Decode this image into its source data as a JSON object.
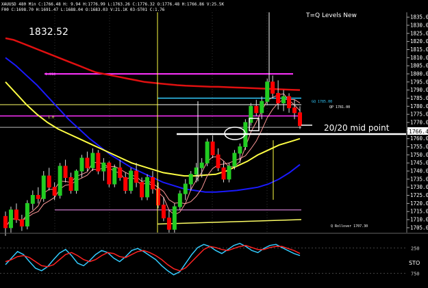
{
  "header": {
    "line1": "XAUUSD 480 Min  C:1766.48  H: 9.94  H:1776.99  L:1763.26  C:1776.32  O:1776.48  H:1766.86  V:25.5K",
    "line2": "F00  C:1698.70  H:1691.47  L:1688.04  O:1683.03  V:21.1K  03-ST01  C:1.76"
  },
  "annotations": {
    "big_price": "1832.52",
    "title": "T=Q Levels New",
    "mid_point": "20/20 mid point",
    "level_1818": "1.818",
    "level_gq": "GQ 1785.00",
    "level_qp": "QP 1781.00",
    "level_small_left": "1.0",
    "level_rollover": "Q Rollover 1707.30",
    "sto_label": "STO"
  },
  "colors": {
    "background": "#000000",
    "up_candle": "#22cc22",
    "down_candle": "#ff0000",
    "ma_red": "#e01010",
    "ma_blue": "#1a1aff",
    "ma_yellow": "#ffff44",
    "ma_pink": "#ff9999",
    "level_magenta": "#ff33ff",
    "level_cyan": "#33ccff",
    "level_white": "#ffffff",
    "sto_red": "#ff2222",
    "sto_cyan": "#33ccff"
  },
  "chart_data": {
    "type": "candlestick",
    "y_ticks": [
      1835,
      1830,
      1825,
      1820,
      1815,
      1810,
      1805,
      1800,
      1795,
      1790,
      1785,
      1780,
      1775,
      1770,
      1765,
      1760,
      1755,
      1750,
      1745,
      1740,
      1735,
      1730,
      1725,
      1720,
      1715,
      1710,
      1705
    ],
    "ylim": [
      1702,
      1838
    ],
    "current_price": "1766.4",
    "ohlc": [
      [
        1712,
        1715,
        1700,
        1705
      ],
      [
        1705,
        1718,
        1702,
        1716
      ],
      [
        1716,
        1720,
        1708,
        1710
      ],
      [
        1710,
        1713,
        1703,
        1706
      ],
      [
        1706,
        1722,
        1704,
        1720
      ],
      [
        1720,
        1728,
        1716,
        1725
      ],
      [
        1725,
        1730,
        1720,
        1723
      ],
      [
        1723,
        1740,
        1721,
        1737
      ],
      [
        1737,
        1742,
        1728,
        1730
      ],
      [
        1730,
        1733,
        1722,
        1725
      ],
      [
        1725,
        1745,
        1723,
        1743
      ],
      [
        1743,
        1747,
        1733,
        1736
      ],
      [
        1736,
        1739,
        1726,
        1728
      ],
      [
        1728,
        1741,
        1726,
        1740
      ],
      [
        1740,
        1750,
        1736,
        1748
      ],
      [
        1748,
        1752,
        1740,
        1742
      ],
      [
        1742,
        1754,
        1740,
        1751
      ],
      [
        1751,
        1753,
        1738,
        1740
      ],
      [
        1740,
        1748,
        1734,
        1745
      ],
      [
        1745,
        1746,
        1730,
        1732
      ],
      [
        1732,
        1744,
        1730,
        1742
      ],
      [
        1742,
        1747,
        1734,
        1736
      ],
      [
        1736,
        1739,
        1726,
        1728
      ],
      [
        1728,
        1742,
        1726,
        1740
      ],
      [
        1740,
        1745,
        1730,
        1733
      ],
      [
        1733,
        1736,
        1722,
        1724
      ],
      [
        1724,
        1738,
        1722,
        1736
      ],
      [
        1736,
        1740,
        1726,
        1729
      ],
      [
        1729,
        1733,
        1717,
        1719
      ],
      [
        1719,
        1724,
        1709,
        1711
      ],
      [
        1711,
        1716,
        1702,
        1704
      ],
      [
        1704,
        1720,
        1702,
        1718
      ],
      [
        1718,
        1728,
        1716,
        1726
      ],
      [
        1726,
        1735,
        1722,
        1732
      ],
      [
        1732,
        1740,
        1728,
        1738
      ],
      [
        1738,
        1745,
        1733,
        1742
      ],
      [
        1742,
        1748,
        1736,
        1745
      ],
      [
        1745,
        1760,
        1743,
        1758
      ],
      [
        1758,
        1762,
        1748,
        1750
      ],
      [
        1750,
        1754,
        1740,
        1742
      ],
      [
        1742,
        1746,
        1733,
        1735
      ],
      [
        1735,
        1745,
        1733,
        1743
      ],
      [
        1743,
        1753,
        1741,
        1751
      ],
      [
        1751,
        1757,
        1745,
        1755
      ],
      [
        1755,
        1772,
        1753,
        1770
      ],
      [
        1770,
        1782,
        1768,
        1780
      ],
      [
        1780,
        1784,
        1774,
        1776
      ],
      [
        1776,
        1786,
        1772,
        1783
      ],
      [
        1783,
        1797,
        1781,
        1795
      ],
      [
        1795,
        1799,
        1785,
        1788
      ],
      [
        1788,
        1796,
        1778,
        1782
      ],
      [
        1782,
        1790,
        1777,
        1786
      ],
      [
        1786,
        1788,
        1776,
        1779
      ],
      [
        1779,
        1784,
        1772,
        1776
      ],
      [
        1776,
        1780,
        1766,
        1768
      ]
    ],
    "moving_averages": [
      {
        "color": "ma_red",
        "values": [
          1822,
          1821,
          1819,
          1817,
          1815,
          1813,
          1811,
          1809,
          1807,
          1805,
          1803,
          1801,
          1800,
          1799,
          1798,
          1797,
          1796,
          1795,
          1794.5,
          1794,
          1793.5,
          1793,
          1792.7,
          1792.5,
          1792.3,
          1792.1,
          1792,
          1791.8,
          1791.6,
          1791.4,
          1791.2,
          1791,
          1790.8,
          1790.6,
          1790.4,
          1790.2,
          1790
        ]
      },
      {
        "color": "ma_blue",
        "values": [
          1810,
          1805,
          1799,
          1793,
          1786,
          1779,
          1772,
          1766,
          1760,
          1755,
          1750,
          1746,
          1742,
          1739,
          1736,
          1733,
          1731,
          1729,
          1728,
          1727,
          1727,
          1727.5,
          1728,
          1729,
          1730,
          1732,
          1735,
          1739,
          1744
        ]
      },
      {
        "color": "ma_yellow",
        "values": [
          1795,
          1788,
          1781,
          1775,
          1770,
          1766,
          1763,
          1760,
          1757,
          1754,
          1751,
          1748,
          1745,
          1743,
          1741,
          1739,
          1738,
          1737,
          1737,
          1737.5,
          1738,
          1740,
          1743,
          1746,
          1750,
          1753,
          1756,
          1758,
          1760
        ]
      }
    ],
    "horizontal_levels": [
      {
        "label": "1.818",
        "value": 1800
      },
      {
        "label": "GQ 1785.00",
        "value": 1785
      },
      {
        "label": "QP 1781.00",
        "value": 1781
      },
      {
        "label": "20/20 mid point",
        "value": 1766.4
      },
      {
        "label": "Q Rollover 1707.30",
        "value": 1707.3
      }
    ],
    "stochastic": {
      "label": "STO",
      "y_ticks": [
        250,
        750
      ],
      "k": [
        42,
        55,
        68,
        62,
        48,
        35,
        30,
        38,
        52,
        65,
        72,
        60,
        45,
        40,
        50,
        62,
        70,
        66,
        55,
        48,
        58,
        70,
        74,
        68,
        60,
        52,
        40,
        30,
        22,
        28,
        45,
        62,
        76,
        82,
        78,
        70,
        64,
        72,
        80,
        84,
        78,
        70,
        66,
        74,
        80,
        82,
        76,
        70,
        64,
        60
      ],
      "d": [
        48,
        52,
        58,
        60,
        56,
        48,
        40,
        38,
        42,
        52,
        62,
        66,
        60,
        52,
        48,
        52,
        60,
        66,
        64,
        58,
        56,
        62,
        68,
        70,
        66,
        60,
        52,
        42,
        34,
        30,
        36,
        48,
        60,
        72,
        78,
        76,
        72,
        70,
        74,
        78,
        80,
        76,
        72,
        72,
        76,
        78,
        78,
        74,
        70,
        64
      ]
    }
  }
}
